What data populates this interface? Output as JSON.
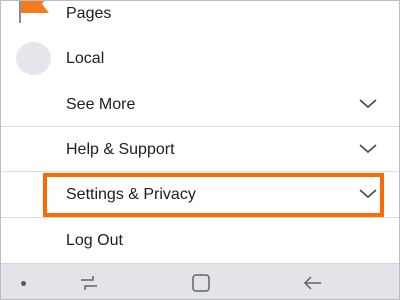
{
  "menu": {
    "items": [
      {
        "label": "Pages",
        "icon": "flag-icon"
      },
      {
        "label": "Local",
        "icon": "avatar"
      },
      {
        "label": "See More",
        "icon": "chevron-down-icon"
      },
      {
        "label": "Help & Support",
        "icon": "chevron-down-icon"
      },
      {
        "label": "Settings & Privacy",
        "icon": "chevron-down-icon",
        "highlighted": true
      },
      {
        "label": "Log Out"
      }
    ]
  },
  "navbar": {
    "buttons": [
      "recents-icon",
      "home-icon",
      "back-icon"
    ]
  },
  "colors": {
    "highlight": "#ff6a00",
    "flag": "#f47b20",
    "text": "#1c1e21",
    "divider": "#dadde1"
  }
}
